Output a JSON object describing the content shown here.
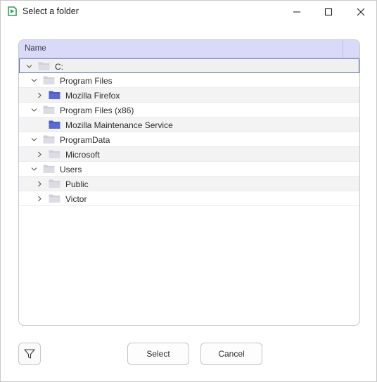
{
  "window": {
    "title": "Select a folder",
    "icons": {
      "app": "app-logo-icon",
      "minimize": "minimize-icon",
      "maximize": "maximize-icon",
      "close": "close-icon"
    }
  },
  "tree": {
    "column_header": "Name",
    "rows": [
      {
        "label": "C:",
        "expanded": true,
        "depth": 0,
        "folder": "light",
        "selected": true
      },
      {
        "label": "Program Files",
        "expanded": true,
        "depth": 1,
        "folder": "light"
      },
      {
        "label": "Mozilla Firefox",
        "expanded": false,
        "depth": 2,
        "folder": "dark"
      },
      {
        "label": "Program Files (x86)",
        "expanded": true,
        "depth": 1,
        "folder": "light"
      },
      {
        "label": "Mozilla Maintenance Service",
        "expanded": null,
        "depth": 2,
        "folder": "dark"
      },
      {
        "label": "ProgramData",
        "expanded": true,
        "depth": 1,
        "folder": "light"
      },
      {
        "label": "Microsoft",
        "expanded": false,
        "depth": 2,
        "folder": "light"
      },
      {
        "label": "Users",
        "expanded": true,
        "depth": 1,
        "folder": "light"
      },
      {
        "label": "Public",
        "expanded": false,
        "depth": 2,
        "folder": "light"
      },
      {
        "label": "Victor",
        "expanded": false,
        "depth": 2,
        "folder": "light"
      }
    ]
  },
  "footer": {
    "filter_icon": "filter-icon",
    "select_label": "Select",
    "cancel_label": "Cancel"
  },
  "colors": {
    "header_bg": "#d9daf7",
    "folder_light": "#cfcfd8",
    "folder_dark": "#4a5cc4",
    "selection_border": "#5c6bbd",
    "app_icon_green": "#2e9e57"
  }
}
